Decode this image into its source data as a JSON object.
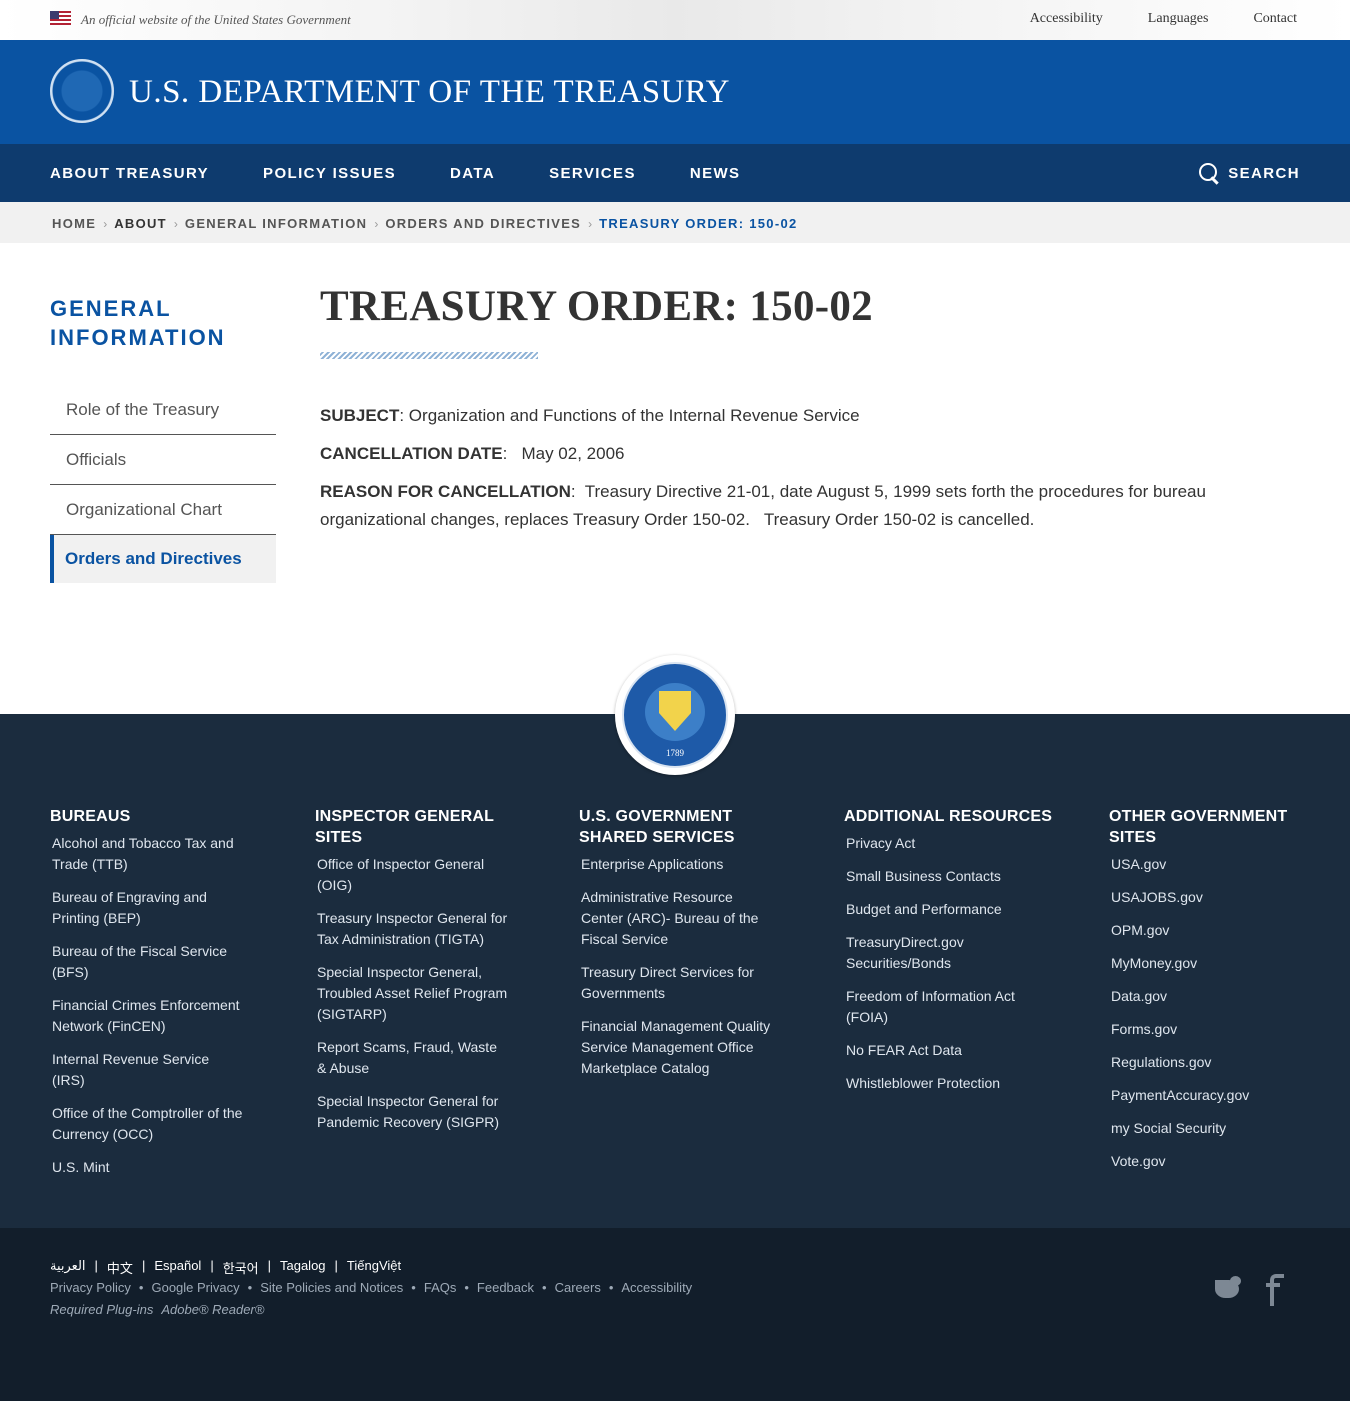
{
  "gov_banner": {
    "official_text": "An official website of the United States Government",
    "links": [
      "Accessibility",
      "Languages",
      "Contact"
    ]
  },
  "header": {
    "site_title": "U.S. DEPARTMENT OF THE TREASURY"
  },
  "main_nav": {
    "items": [
      "ABOUT TREASURY",
      "POLICY ISSUES",
      "DATA",
      "SERVICES",
      "NEWS"
    ],
    "search_label": "SEARCH"
  },
  "breadcrumb": {
    "items": [
      "HOME",
      "ABOUT",
      "GENERAL INFORMATION",
      "ORDERS AND DIRECTIVES"
    ],
    "current": "TREASURY ORDER: 150-02"
  },
  "sidebar": {
    "title": "GENERAL INFORMATION",
    "items": [
      "Role of the Treasury",
      "Officials",
      "Organizational Chart",
      "Orders and Directives"
    ]
  },
  "page": {
    "title": "TREASURY ORDER: 150-02",
    "subject_label": "SUBJECT",
    "subject_value": ": Organization and Functions of the Internal Revenue Service",
    "cancellation_label": "CANCELLATION DATE",
    "cancellation_value": ":   May 02, 2006",
    "reason_label": "REASON FOR CANCELLATION",
    "reason_value": ":  Treasury Directive 21-01, date August 5, 1999 sets forth the procedures for bureau organizational changes, replaces Treasury Order 150-02.   Treasury Order 150-02 is cancelled."
  },
  "footer": {
    "seal_year": "1789",
    "columns": [
      {
        "heading": "BUREAUS",
        "links": [
          "Alcohol and Tobacco Tax and Trade (TTB)",
          "Bureau of Engraving and Printing (BEP)",
          "Bureau of the Fiscal Service (BFS)",
          "Financial Crimes Enforcement Network (FinCEN)",
          "Internal Revenue Service (IRS)",
          "Office of the Comptroller of the Currency (OCC)",
          "U.S. Mint"
        ]
      },
      {
        "heading": "INSPECTOR GENERAL SITES",
        "links": [
          "Office of Inspector General (OIG)",
          "Treasury Inspector General for Tax Administration (TIGTA)",
          "Special Inspector General, Troubled Asset Relief Program (SIGTARP)",
          "Report Scams, Fraud, Waste & Abuse",
          "Special Inspector General for Pandemic Recovery (SIGPR)"
        ]
      },
      {
        "heading": "U.S. GOVERNMENT SHARED SERVICES",
        "links": [
          "Enterprise Applications",
          "Administrative Resource Center (ARC)- Bureau of the Fiscal Service",
          "Treasury Direct Services for Governments",
          "Financial Management Quality Service Management Office Marketplace Catalog"
        ]
      },
      {
        "heading": "ADDITIONAL RESOURCES",
        "links": [
          "Privacy Act",
          "Small Business Contacts",
          "Budget and Performance",
          "TreasuryDirect.gov Securities/Bonds",
          "Freedom of Information Act (FOIA)",
          "No FEAR Act Data",
          "Whistleblower Protection"
        ]
      },
      {
        "heading": "OTHER GOVERNMENT SITES",
        "links": [
          "USA.gov",
          "USAJOBS.gov",
          "OPM.gov",
          "MyMoney.gov",
          "Data.gov",
          "Forms.gov",
          "Regulations.gov",
          "PaymentAccuracy.gov",
          "my Social Security",
          "Vote.gov"
        ]
      }
    ],
    "languages": [
      "العربية",
      "中文",
      "Español",
      "한국어",
      "Tagalog",
      "TiếngViệt"
    ],
    "links": [
      "Privacy Policy",
      "Google Privacy",
      "Site Policies and Notices",
      "FAQs",
      "Feedback",
      "Careers",
      "Accessibility"
    ],
    "plugins_label": "Required Plug-ins",
    "plugins_link": "Adobe® Reader®",
    "social": [
      "twitter-icon",
      "facebook-icon"
    ]
  }
}
